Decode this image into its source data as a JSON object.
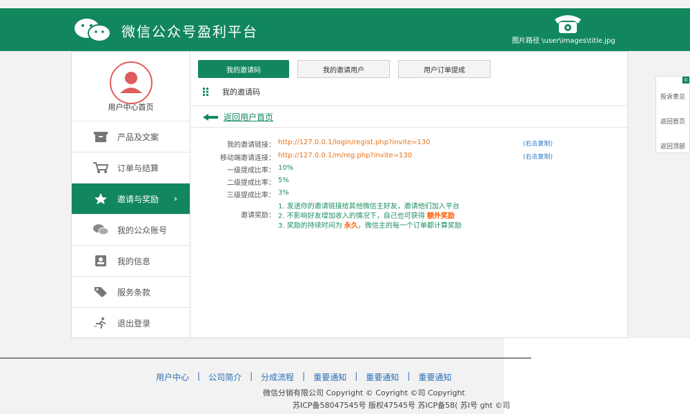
{
  "header": {
    "brand": "微信公众号盈利平台",
    "image_path": "图片路径 \\user\\images\\title.jpg",
    "logo_icon": "wechat-logo-icon",
    "phone_icon": "telephone-icon"
  },
  "sidebar": {
    "user_center": "用户中心首页",
    "items": [
      {
        "label": "产品及文案",
        "icon": "box-icon"
      },
      {
        "label": "订单与结算",
        "icon": "cart-icon"
      },
      {
        "label": "邀请与奖励",
        "icon": "star-icon",
        "arrow": "›"
      },
      {
        "label": "我的公众账号",
        "icon": "wechat-icon"
      },
      {
        "label": "我的信息",
        "icon": "id-card-icon"
      },
      {
        "label": "服务条款",
        "icon": "tag-icon"
      },
      {
        "label": "退出登录",
        "icon": "running-man-icon"
      }
    ]
  },
  "tabs": [
    {
      "label": "我的邀请码"
    },
    {
      "label": "我的邀请用户"
    },
    {
      "label": "用户订单提成"
    }
  ],
  "section_title": "我的邀请码",
  "back_link": "返回用户首页",
  "info": {
    "invite_link_label": "我的邀请链接：",
    "invite_link": "http://127.0.0.1/login/regist.php?invite=130",
    "mobile_link_label": "移动端邀请连接：",
    "mobile_link": "http://127.0.0.1/m/reg.php?invite=130",
    "copy_label": "(右击复制)",
    "level1_label": "一级提成比率：",
    "level1_value": "10%",
    "level2_label": "二级提成比率：",
    "level2_value": "5%",
    "level3_label": "三级提成比率：",
    "level3_value": "3%",
    "reward_label": "邀请奖励：",
    "reward_line1": "1. 发送你的邀请链接给其他微信主好友，邀请他们加入平台",
    "reward_line2_a": "2. 不影响好友增加收入的情况下，自己也可获得 ",
    "reward_line2_b": "额外奖励",
    "reward_line3_a": "3. 奖励的持续时间为 ",
    "reward_line3_b": "永久",
    "reward_line3_c": "，微信主的每一个订单都计算奖励"
  },
  "float_panel": {
    "top": "0",
    "items": [
      "投诉意见",
      "返回首页",
      "返回顶部"
    ]
  },
  "footer": {
    "links": [
      "用户中心",
      "公司简介",
      "分成流程",
      "重要通知",
      "重要通知",
      "重要通知"
    ],
    "separator": "|",
    "copyright": "微信分销有限公司    Copyright ©     Coyright ©司    Copyright",
    "icp": "苏ICP备58047545号 版权47545号  苏ICP备58(  苏I号  ght  ©司"
  },
  "colors": {
    "brand_green": "#12875d",
    "link_orange": "#e4731c",
    "text_green": "#1a8f5e",
    "link_blue": "#2a7bc4",
    "highlight_red": "#ff5a00"
  }
}
